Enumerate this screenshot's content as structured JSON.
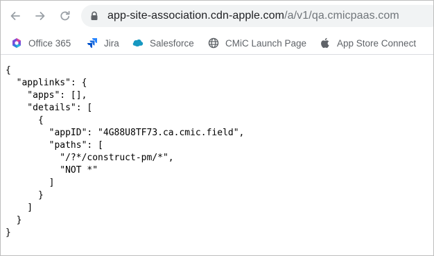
{
  "browser": {
    "url": {
      "host": "app-site-association.cdn-apple.com",
      "path": "/a/v1/qa.cmicpaas.com"
    },
    "nav": {
      "back_icon": "arrow-left-icon",
      "forward_icon": "arrow-right-icon",
      "reload_icon": "reload-icon",
      "lock_icon": "lock-icon"
    },
    "bookmarks": [
      {
        "label": "Office 365",
        "icon": "office-365-icon"
      },
      {
        "label": "Jira",
        "icon": "jira-icon"
      },
      {
        "label": "Salesforce",
        "icon": "salesforce-cloud-icon"
      },
      {
        "label": "CMiC Launch Page",
        "icon": "globe-icon"
      },
      {
        "label": "App Store Connect",
        "icon": "apple-icon"
      }
    ]
  },
  "content": {
    "lines": [
      "{",
      "  \"applinks\": {",
      "    \"apps\": [],",
      "    \"details\": [",
      "      {",
      "        \"appID\": \"4G88U8TF73.ca.cmic.field\",",
      "        \"paths\": [",
      "          \"/?*/construct-pm/*\",",
      "          \"NOT *\"",
      "        ]",
      "      }",
      "    ]",
      "  }",
      "}"
    ]
  },
  "colors": {
    "omnibox_bg": "#f1f3f4",
    "url_host": "#202124",
    "url_path": "#70757a",
    "bookmark_text": "#5f6368",
    "office_accent": "#7b4fd8",
    "jira_blue": "#2684ff",
    "salesforce_blue": "#1798c1"
  }
}
